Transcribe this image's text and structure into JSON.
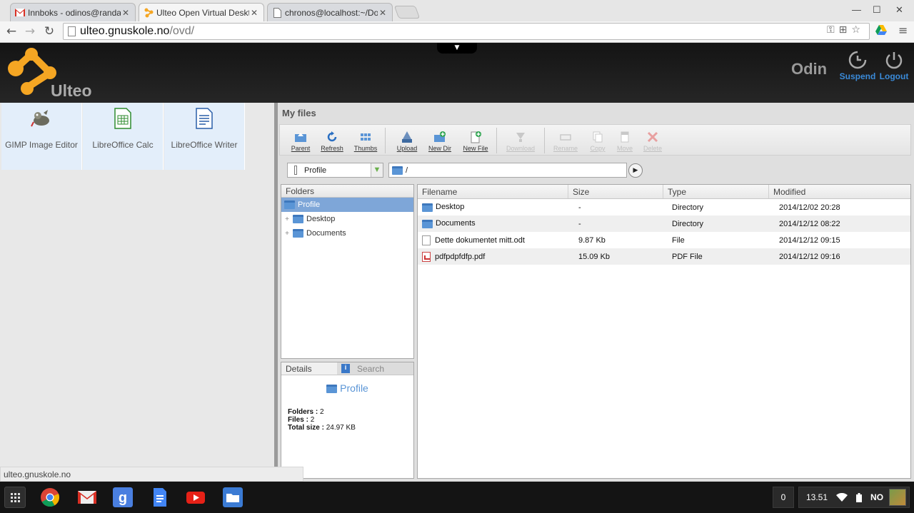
{
  "browser": {
    "tabs": [
      {
        "title": "Innboks - odinos@randal",
        "icon": "gmail-icon"
      },
      {
        "title": "Ulteo Open Virtual Deskt",
        "icon": "ulteo-icon"
      },
      {
        "title": "chronos@localhost:~/Do",
        "icon": "page-icon"
      }
    ],
    "address": {
      "host": "ulteo.gnuskole.no",
      "path": "/ovd/"
    }
  },
  "header": {
    "logo": "Ulteo",
    "user": "Odin",
    "suspend": "Suspend",
    "logout": "Logout",
    "dropper": "▼"
  },
  "apps": [
    {
      "label": "GIMP Image Editor",
      "icon": "gimp-icon"
    },
    {
      "label": "LibreOffice Calc",
      "icon": "calc-icon"
    },
    {
      "label": "LibreOffice Writer",
      "icon": "writer-icon"
    }
  ],
  "status_url": "ulteo.gnuskole.no",
  "fm": {
    "title": "My files",
    "toolbar": [
      {
        "label": "Parent",
        "enabled": true
      },
      {
        "label": "Refresh",
        "enabled": true
      },
      {
        "label": "Thumbs",
        "enabled": true
      },
      {
        "label": "Upload",
        "enabled": true
      },
      {
        "label": "New Dir",
        "enabled": true
      },
      {
        "label": "New File",
        "enabled": true
      },
      {
        "label": "Download",
        "enabled": false
      },
      {
        "label": "Rename",
        "enabled": false
      },
      {
        "label": "Copy",
        "enabled": false
      },
      {
        "label": "Move",
        "enabled": false
      },
      {
        "label": "Delete",
        "enabled": false
      }
    ],
    "source": "Profile",
    "path": "/",
    "folders_title": "Folders",
    "tree": {
      "root": "Profile",
      "children": [
        "Desktop",
        "Documents"
      ]
    },
    "details": {
      "tab": "Details",
      "search": "Search",
      "name": "Profile",
      "folders_label": "Folders :",
      "folders_value": "2",
      "files_label": "Files :",
      "files_value": "2",
      "size_label": "Total size :",
      "size_value": "24.97 KB"
    },
    "columns": [
      "Filename",
      "Size",
      "Type",
      "Modified"
    ],
    "files": [
      {
        "name": "Desktop",
        "size": "-",
        "type": "Directory",
        "modified": "2014/12/02 20:28",
        "kind": "folder"
      },
      {
        "name": "Documents",
        "size": "-",
        "type": "Directory",
        "modified": "2014/12/12 08:22",
        "kind": "folder"
      },
      {
        "name": "Dette dokumentet mitt.odt",
        "size": "9.87 Kb",
        "type": "File",
        "modified": "2014/12/12 09:15",
        "kind": "doc"
      },
      {
        "name": "pdfpdpfdfp.pdf",
        "size": "15.09 Kb",
        "type": "PDF File",
        "modified": "2014/12/12 09:16",
        "kind": "pdf"
      }
    ]
  },
  "taskbar": {
    "notifications": "0",
    "clock": "13.51",
    "lang": "NO"
  }
}
